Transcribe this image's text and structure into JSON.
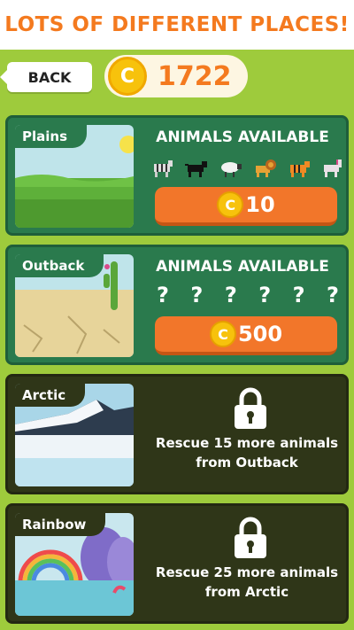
{
  "header": {
    "title": "LOTS OF DIFFERENT PLACES!"
  },
  "top_bar": {
    "back_label": "BACK",
    "coin_symbol": "C",
    "coin_balance": "1722"
  },
  "places": [
    {
      "name": "Plains",
      "available_label": "ANIMALS AVAILABLE",
      "animals": [
        "zebra-icon",
        "panther-icon",
        "sheep-icon",
        "lion-icon",
        "tiger-icon",
        "horse-icon"
      ],
      "price": "10",
      "coin_symbol": "C"
    },
    {
      "name": "Outback",
      "available_label": "ANIMALS AVAILABLE",
      "unknown": [
        "?",
        "?",
        "?",
        "?",
        "?",
        "?"
      ],
      "price": "500",
      "coin_symbol": "C"
    },
    {
      "name": "Arctic",
      "locked_text": "Rescue 15 more animals from Outback"
    },
    {
      "name": "Rainbow",
      "locked_text": "Rescue 25 more animals from Arctic"
    }
  ],
  "colors": {
    "accent": "#f47a1f",
    "card_unlocked": "#2a7a4d",
    "card_locked": "#2f3618",
    "buy_button": "#f2762a",
    "coin": "#f7c20c"
  }
}
